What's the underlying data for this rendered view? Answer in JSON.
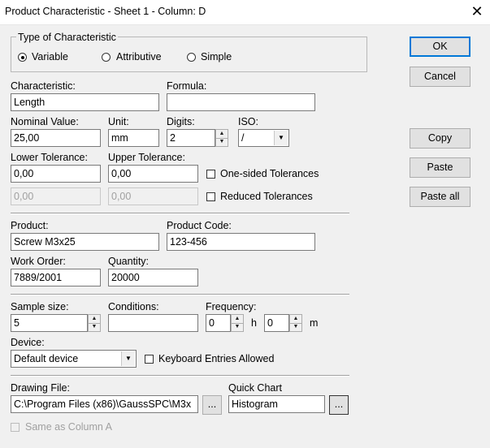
{
  "window": {
    "title": "Product Characteristic - Sheet 1 - Column: D",
    "close_glyph": "✕"
  },
  "type_group": {
    "label": "Type of Characteristic",
    "options": [
      {
        "label": "Variable",
        "selected": true
      },
      {
        "label": "Attributive",
        "selected": false
      },
      {
        "label": "Simple",
        "selected": false
      }
    ]
  },
  "buttons": {
    "ok": "OK",
    "cancel": "Cancel",
    "copy": "Copy",
    "paste": "Paste",
    "paste_all": "Paste all"
  },
  "characteristic": {
    "label": "Characteristic:",
    "value": "Length"
  },
  "formula": {
    "label": "Formula:",
    "value": ""
  },
  "nominal": {
    "label": "Nominal Value:",
    "value": "25,00"
  },
  "unit": {
    "label": "Unit:",
    "value": "mm"
  },
  "digits": {
    "label": "Digits:",
    "value": "2"
  },
  "iso": {
    "label": "ISO:",
    "value": "/"
  },
  "lower_tol": {
    "label": "Lower Tolerance:",
    "value": "0,00",
    "value2": "0,00"
  },
  "upper_tol": {
    "label": "Upper Tolerance:",
    "value": "0,00",
    "value2": "0,00"
  },
  "one_sided": {
    "label": "One-sided Tolerances",
    "checked": false
  },
  "reduced": {
    "label": "Reduced Tolerances",
    "checked": false
  },
  "product": {
    "label": "Product:",
    "value": "Screw M3x25"
  },
  "product_code": {
    "label": "Product Code:",
    "value": "123-456"
  },
  "work_order": {
    "label": "Work Order:",
    "value": "7889/2001"
  },
  "quantity": {
    "label": "Quantity:",
    "value": "20000"
  },
  "sample_size": {
    "label": "Sample size:",
    "value": "5"
  },
  "conditions": {
    "label": "Conditions:",
    "value": ""
  },
  "frequency": {
    "label": "Frequency:",
    "hours": "0",
    "hours_unit": "h",
    "minutes": "0",
    "minutes_unit": "m"
  },
  "device": {
    "label": "Device:",
    "value": "Default device"
  },
  "keyboard": {
    "label": "Keyboard Entries Allowed",
    "checked": false
  },
  "drawing_file": {
    "label": "Drawing File:",
    "value": "C:\\Program Files (x86)\\GaussSPC\\M3x",
    "browse": "..."
  },
  "quick_chart": {
    "label": "Quick Chart",
    "value": "Histogram",
    "browse": "..."
  },
  "same_as": {
    "label": "Same as Column A",
    "checked": false
  }
}
